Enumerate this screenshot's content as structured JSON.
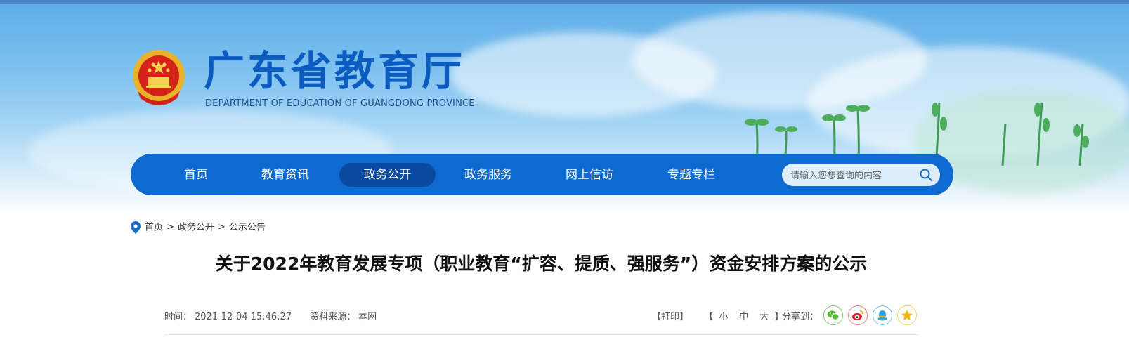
{
  "header": {
    "title": "广东省教育厅",
    "subtitle": "DEPARTMENT OF EDUCATION OF GUANGDONG PROVINCE"
  },
  "nav": {
    "items": [
      {
        "label": "首页"
      },
      {
        "label": "教育资讯"
      },
      {
        "label": "政务公开"
      },
      {
        "label": "政务服务"
      },
      {
        "label": "网上信访"
      },
      {
        "label": "专题专栏"
      }
    ],
    "active": "政务公开",
    "search_placeholder": "请输入您想查询的内容"
  },
  "breadcrumb": {
    "items": [
      "首页",
      "政务公开",
      "公示公告"
    ],
    "separator": ">"
  },
  "article": {
    "title": "关于2022年教育发展专项（职业教育“扩容、提质、强服务”）资金安排方案的公示",
    "time_label": "时间：",
    "time": "2021-12-04 15:46:27",
    "source_label": "资料来源：",
    "source": "本网"
  },
  "tools": {
    "print": "【打印】",
    "font_open": "【",
    "font_small": "小",
    "font_medium": "中",
    "font_large": "大",
    "font_close": "】",
    "share_label": "分享到："
  },
  "share_icons": [
    "wechat-icon",
    "weibo-icon",
    "qq-icon",
    "qzone-icon"
  ],
  "colors": {
    "nav_bg": "#0f6ad0",
    "nav_active": "#0a4aa0",
    "title_blue": "#0c5cbf",
    "wechat": "#55b837",
    "weibo": "#e6162d",
    "qq": "#2d9ee0",
    "qzone": "#f5b700"
  }
}
